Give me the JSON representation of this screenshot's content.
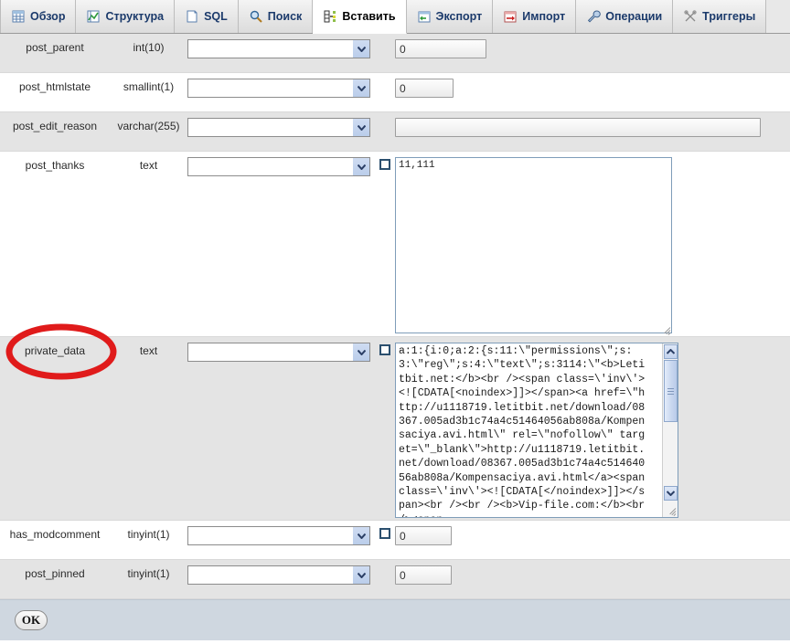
{
  "tabs": [
    {
      "label": "Обзор",
      "icon": "browse-table-icon",
      "active": false
    },
    {
      "label": "Структура",
      "icon": "structure-icon",
      "active": false
    },
    {
      "label": "SQL",
      "icon": "sql-page-icon",
      "active": false
    },
    {
      "label": "Поиск",
      "icon": "search-icon",
      "active": false
    },
    {
      "label": "Вставить",
      "icon": "insert-row-icon",
      "active": true
    },
    {
      "label": "Экспорт",
      "icon": "export-icon",
      "active": false
    },
    {
      "label": "Импорт",
      "icon": "import-icon",
      "active": false
    },
    {
      "label": "Операции",
      "icon": "wrench-icon",
      "active": false
    },
    {
      "label": "Триггеры",
      "icon": "triggers-icon",
      "active": false
    }
  ],
  "rows": [
    {
      "field": "post_parent",
      "type": "int(10)",
      "function": "",
      "function_placeholder": "",
      "null_checkbox": false,
      "value_kind": "input",
      "value_width": "w-int",
      "value": "0"
    },
    {
      "field": "post_htmlstate",
      "type": "smallint(1)",
      "function": "",
      "function_placeholder": "",
      "null_checkbox": false,
      "value_kind": "input",
      "value_width": "w-small",
      "value": "0"
    },
    {
      "field": "post_edit_reason",
      "type": "varchar(255)",
      "function": "",
      "function_placeholder": "",
      "null_checkbox": false,
      "value_kind": "input",
      "value_width": "w-varchar",
      "value": ""
    },
    {
      "field": "post_thanks",
      "type": "text",
      "function": "",
      "function_placeholder": "",
      "null_checkbox": true,
      "value_kind": "textarea",
      "value": "11,111"
    },
    {
      "field": "private_data",
      "type": "text",
      "function": "",
      "function_placeholder": "",
      "null_checkbox": true,
      "value_kind": "textarea-scroll",
      "value": "a:1:{i:0;a:2:{s:11:\\\"permissions\\\";s:3:\\\"reg\\\";s:4:\\\"text\\\";s:3114:\\\"<b>Letitbit.net:</b><br /><span class=\\'inv\\'><![CDATA[<noindex>]]></span><a href=\\\"http://u1118719.letitbit.net/download/08367.005ad3b1c74a4c51464056ab808a/Kompensaciya.avi.html\\\" rel=\\\"nofollow\\\" target=\\\"_blank\\\">http://u1118719.letitbit.net/download/08367.005ad3b1c74a4c51464056ab808a/Kompensaciya.avi.html</a><span class=\\'inv\\'><![CDATA[</noindex>]]></span><br /><br /><b>Vip-file.com:</b><br /><span"
    },
    {
      "field": "has_modcomment",
      "type": "tinyint(1)",
      "function": "",
      "function_placeholder": "",
      "null_checkbox": true,
      "value_kind": "input",
      "value_width": "w-tiny",
      "value": "0"
    },
    {
      "field": "post_pinned",
      "type": "tinyint(1)",
      "function": "",
      "function_placeholder": "",
      "null_checkbox": false,
      "value_kind": "input",
      "value_width": "w-tiny",
      "value": "0"
    }
  ],
  "footer": {
    "ok_label": "OK"
  },
  "annotation": {
    "shape": "ellipse",
    "color": "#e01b1b",
    "targets": "private_data"
  },
  "colors": {
    "tab_text": "#1b3a6b",
    "row_odd": "#e4e4e4",
    "row_even": "#ffffff",
    "footer_bg": "#cfd7e0",
    "annotation_red": "#e01b1b"
  }
}
